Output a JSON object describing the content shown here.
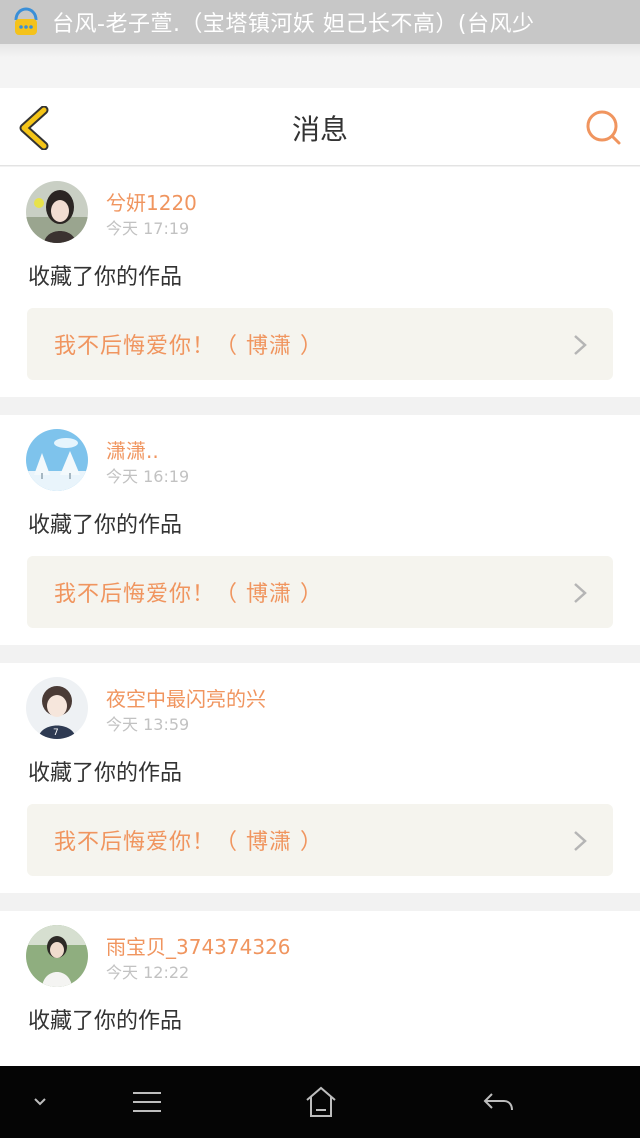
{
  "status_bar": {
    "notification_text": "台风-老子萱.（宝塔镇河妖 妲己长不高）(台风少"
  },
  "header": {
    "title": "消息"
  },
  "colors": {
    "accent": "#f0955f",
    "back_arrow": "#f5c518",
    "work_box_bg": "#f5f4ee"
  },
  "messages": [
    {
      "username": "兮妍1220",
      "time": "今天 17:19",
      "action": "收藏了你的作品",
      "work_title": "我不后悔爱你！（ 博潇 ）",
      "avatar": "avatar-girl-icon"
    },
    {
      "username": "潇潇..",
      "time": "今天 16:19",
      "action": "收藏了你的作品",
      "work_title": "我不后悔爱你！（ 博潇 ）",
      "avatar": "avatar-winter-icon"
    },
    {
      "username": "夜空中最闪亮的兴",
      "time": "今天 13:59",
      "action": "收藏了你的作品",
      "work_title": "我不后悔爱你！（ 博潇 ）",
      "avatar": "avatar-boy-icon"
    },
    {
      "username": "雨宝贝_374374326",
      "time": "今天 12:22",
      "action": "收藏了你的作品",
      "work_title": "",
      "avatar": "avatar-person-icon"
    }
  ],
  "nav_bar": {
    "icons": [
      "chevron-down-icon",
      "menu-icon",
      "home-icon",
      "back-icon"
    ]
  }
}
